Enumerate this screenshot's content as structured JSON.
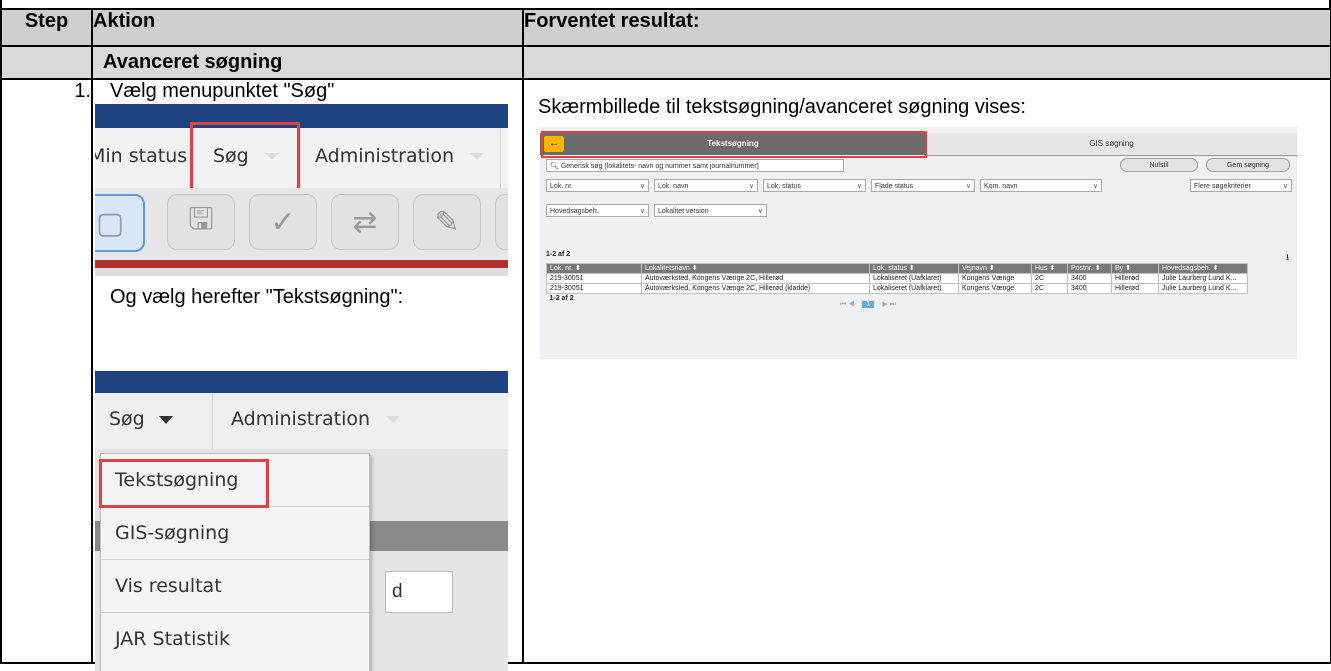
{
  "table": {
    "headers": {
      "step": "Step",
      "action": "Aktion",
      "expected": "Forventet resultat:"
    },
    "section_title": "Avanceret søgning",
    "row": {
      "step": "1.",
      "action_text_1": "Vælg menupunktet \"Søg\"",
      "action_text_2": "Og vælg herefter \"Tekstsøgning\":",
      "expected_text": "Skærmbillede til tekstsøgning/avanceret søgning vises:"
    }
  },
  "screenshot1": {
    "menu": {
      "item1": "Min status",
      "item2": "Søg",
      "item3": "Administration"
    },
    "toolbar_icons": [
      "file-icon",
      "save-icon",
      "check-icon",
      "swap-icon",
      "edit-icon"
    ]
  },
  "screenshot2": {
    "menu": {
      "item1": "Søg",
      "item2": "Administration"
    },
    "dropdown": [
      "Tekstsøgning",
      "GIS-søgning",
      "Vis resultat",
      "JAR Statistik"
    ],
    "side_text": "d"
  },
  "screenshot3": {
    "tabs": {
      "active": "Tekstsøgning",
      "other": "GIS søgning"
    },
    "back_icon": "←",
    "search_placeholder": "Generisk søg (lokalitets- navn og nummer samt journalnummer)",
    "buttons": {
      "reset": "Nulstil",
      "save": "Gem søgning"
    },
    "filters_row1": [
      "Lok. nr.",
      "Lok. navn",
      "Lok. status",
      "Flade status",
      "Kom. navn"
    ],
    "more_criteria": "Flere søgekriterier",
    "filters_row2": [
      "Hovedsagsbeh.",
      "Lokalitet version"
    ],
    "count_top": "1-2 af 2",
    "count_bottom": "1-2 af 2",
    "columns": [
      "Lok. nr. ⬍",
      "Lokalitetsnavn ⬍",
      "Lok. status ⬍",
      "Vejnavn ⬍",
      "Hus ⬍",
      "Postnr. ⬍",
      "By ⬍",
      "Hovedsagsbeh. ⬍"
    ],
    "rows": [
      [
        "219-30051",
        "Autoværksted, Kongens Vænge 2C, Hillerød",
        "Lokaliseret (Uafklaret)",
        "Kongens Vænge",
        "2C",
        "3400",
        "Hillerød",
        "Julie Laurberg Lund K..."
      ],
      [
        "219-30051",
        "Autoværksted, Kongens Vænge 2C, Hillerød (kladde)",
        "Lokaliseret (Uafklaret)",
        "Kongens Vænge",
        "2C",
        "3400",
        "Hillerød",
        "Julie Laurberg Lund K..."
      ]
    ],
    "pager": {
      "first": "⏮",
      "prev": "◀",
      "page": "1",
      "next": "▶",
      "last": "⏭"
    }
  }
}
